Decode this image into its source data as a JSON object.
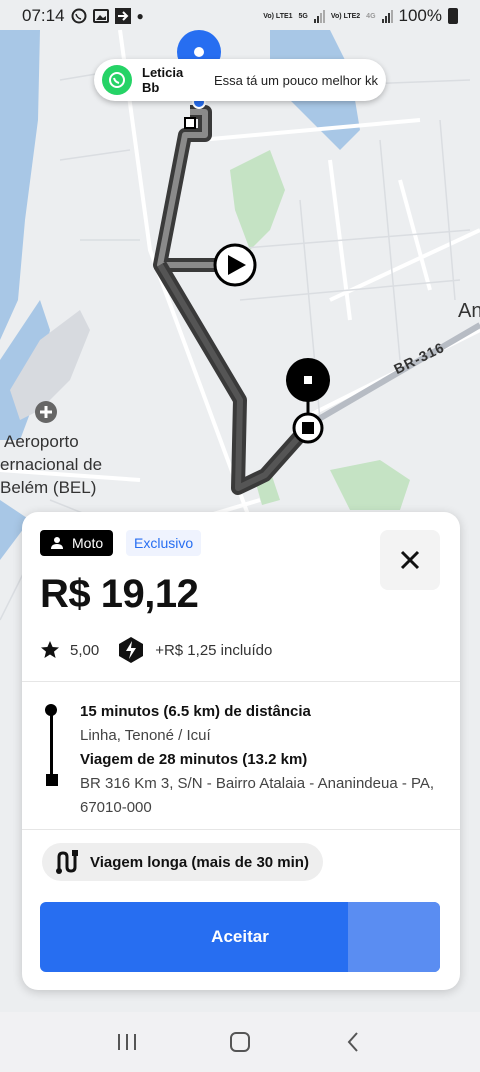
{
  "status": {
    "time": "07:14",
    "net1_label": "Vo) LTE1",
    "net1_badge": "5G",
    "net2_label": "Vo) LTE2",
    "net2_badge": "4G",
    "battery": "100%"
  },
  "notification": {
    "sender": "Leticia Bb",
    "message": "Essa tá um pouco melhor kk",
    "icon": "whatsapp-icon"
  },
  "map": {
    "airport_line1": "Aeroporto",
    "airport_line2": "ernacional de",
    "airport_line3": "Belém (BEL)",
    "road_label": "BR-316",
    "edge_label": "An"
  },
  "card": {
    "badge_type": "Moto",
    "badge_tag": "Exclusivo",
    "price": "R$ 19,12",
    "rating": "5,00",
    "fee": "+R$ 1,25 incluído",
    "pickup_eta": "15 minutos (6.5 km) de distância",
    "pickup_area": "Linha, Tenoné / Icuí",
    "trip_duration": "Viagem de 28 minutos (13.2 km)",
    "dropoff_address": "BR 316 Km 3, S/N - Bairro Atalaia - Ananindeua - PA, 67010-000",
    "long_trip": "Viagem longa (mais de 30 min)",
    "accept_label": "Aceitar"
  },
  "colors": {
    "accent": "#276ef1",
    "whatsapp": "#25d366"
  }
}
